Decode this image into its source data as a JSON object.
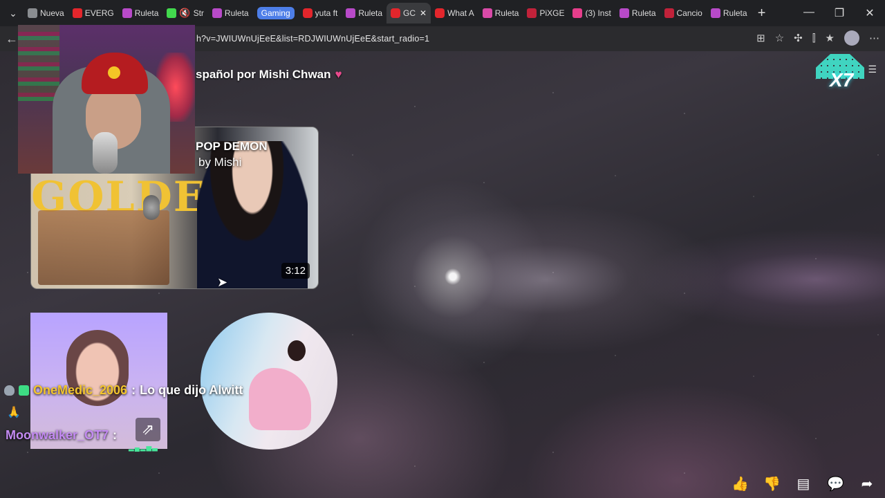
{
  "tabs": [
    {
      "label": "Nueva",
      "color": "#8a8d91"
    },
    {
      "label": "EVERG",
      "color": "#e3262c"
    },
    {
      "label": "Ruleta",
      "color": "#b84ac9"
    },
    {
      "label": "Str",
      "color": "#42d94d"
    },
    {
      "label": "Ruleta",
      "color": "#b84ac9"
    },
    {
      "label": "Gaming",
      "color": "#4d7ee8",
      "group": true
    },
    {
      "label": "yuta ft",
      "color": "#e3262c"
    },
    {
      "label": "Ruleta",
      "color": "#b84ac9"
    },
    {
      "label": "GC",
      "color": "#e3262c",
      "active": true
    },
    {
      "label": "What A",
      "color": "#e3262c"
    },
    {
      "label": "Ruleta",
      "color": "#d94aa8"
    },
    {
      "label": "PiXGE",
      "color": "#c1223a"
    },
    {
      "label": "(3) Inst",
      "color": "#e63e8b"
    },
    {
      "label": "Ruleta",
      "color": "#b84ac9"
    },
    {
      "label": "Cancio",
      "color": "#c1223a"
    },
    {
      "label": "Ruleta",
      "color": "#b84ac9"
    }
  ],
  "address": {
    "url": "h?v=JWIUWnUjEeE&list=RDJWIUWnUjEeE&start_radio=1"
  },
  "video": {
    "title": "spañol por Mishi Chwan",
    "heart": "♥",
    "thumb_title_line1": "POP DEMON",
    "thumb_title_line2": "by Mishi",
    "thumb_bg_text": "GOLDEN",
    "duration": "3:12"
  },
  "chat": [
    {
      "user": "OneMedic_2006",
      "message": "Lo que dijo Alwitt",
      "color": "#f2c42d"
    },
    {
      "user": "Moonwalker_OT7",
      "message": "",
      "color": "#c38af2"
    }
  ],
  "logo_text": "X7",
  "icons": {
    "like": "thumbs-up-icon",
    "dislike": "thumbs-down-icon",
    "comments": "comment-icon",
    "chat": "chat-icon",
    "share": "share-icon"
  }
}
